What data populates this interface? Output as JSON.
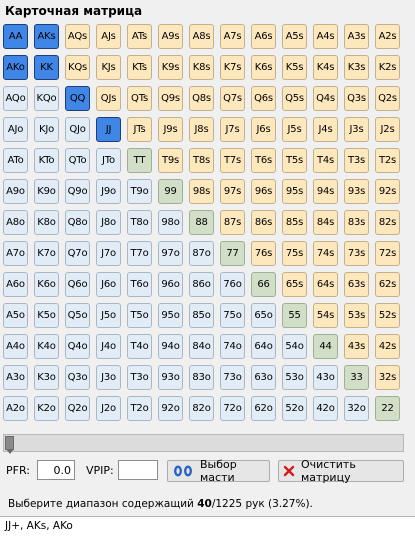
{
  "title": "Карточная матрица",
  "matrix": {
    "rows": [
      [
        "AA",
        "AKs",
        "AQs",
        "AJs",
        "ATs",
        "A9s",
        "A8s",
        "A7s",
        "A6s",
        "A5s",
        "A4s",
        "A3s",
        "A2s"
      ],
      [
        "AKo",
        "KK",
        "KQs",
        "KJs",
        "KTs",
        "K9s",
        "K8s",
        "K7s",
        "K6s",
        "K5s",
        "K4s",
        "K3s",
        "K2s"
      ],
      [
        "AQo",
        "KQo",
        "QQ",
        "QJs",
        "QTs",
        "Q9s",
        "Q8s",
        "Q7s",
        "Q6s",
        "Q5s",
        "Q4s",
        "Q3s",
        "Q2s"
      ],
      [
        "AJo",
        "KJo",
        "QJo",
        "JJ",
        "JTs",
        "J9s",
        "J8s",
        "J7s",
        "J6s",
        "J5s",
        "J4s",
        "J3s",
        "J2s"
      ],
      [
        "ATo",
        "KTo",
        "QTo",
        "JTo",
        "TT",
        "T9s",
        "T8s",
        "T7s",
        "T6s",
        "T5s",
        "T4s",
        "T3s",
        "T2s"
      ],
      [
        "A9o",
        "K9o",
        "Q9o",
        "J9o",
        "T9o",
        "99",
        "98s",
        "97s",
        "96s",
        "95s",
        "94s",
        "93s",
        "92s"
      ],
      [
        "A8o",
        "K8o",
        "Q8o",
        "J8o",
        "T8o",
        "98o",
        "88",
        "87s",
        "86s",
        "85s",
        "84s",
        "83s",
        "82s"
      ],
      [
        "A7o",
        "K7o",
        "Q7o",
        "J7o",
        "T7o",
        "97o",
        "87o",
        "77",
        "76s",
        "75s",
        "74s",
        "73s",
        "72s"
      ],
      [
        "A6o",
        "K6o",
        "Q6o",
        "J6o",
        "T6o",
        "96o",
        "86o",
        "76o",
        "66",
        "65s",
        "64s",
        "63s",
        "62s"
      ],
      [
        "A5o",
        "K5o",
        "Q5o",
        "J5o",
        "T5o",
        "95o",
        "85o",
        "75o",
        "65o",
        "55",
        "54s",
        "53s",
        "52s"
      ],
      [
        "A4o",
        "K4o",
        "Q4o",
        "J4o",
        "T4o",
        "94o",
        "84o",
        "74o",
        "64o",
        "54o",
        "44",
        "43s",
        "42s"
      ],
      [
        "A3o",
        "K3o",
        "Q3o",
        "J3o",
        "T3o",
        "93o",
        "83o",
        "73o",
        "63o",
        "53o",
        "43o",
        "33",
        "32s"
      ],
      [
        "A2o",
        "K2o",
        "Q2o",
        "J2o",
        "T2o",
        "92o",
        "82o",
        "72o",
        "62o",
        "52o",
        "42o",
        "32o",
        "22"
      ]
    ],
    "selected": [
      "AA",
      "KK",
      "QQ",
      "JJ",
      "AKs",
      "AKo"
    ]
  },
  "colors": {
    "selected": "#3f86e6",
    "suited": "#fde8bd",
    "offsuit": "#e1ecf6",
    "pair": "#d1dfc8"
  },
  "range_slider": {
    "value": 0
  },
  "pfr": {
    "label": "PFR:",
    "value": "0.0"
  },
  "vpip": {
    "label": "VPIP:",
    "value": ""
  },
  "buttons": {
    "suit_select": {
      "label": "Выбор масти",
      "icon": "cards-icon"
    },
    "clear_matrix": {
      "label": "Очистить матрицу",
      "icon": "close-icon"
    }
  },
  "status": {
    "prefix": "Выберите диапазон содержащий ",
    "selected_combos": "40",
    "suffix": "/1225 рук (3.27%)."
  },
  "summary": "JJ+, AKs, AKo"
}
